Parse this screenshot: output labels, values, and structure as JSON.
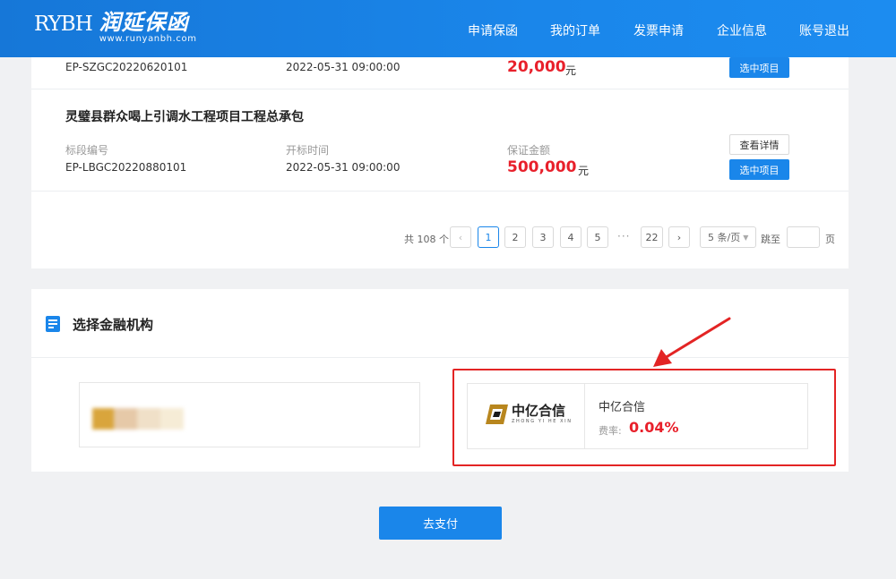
{
  "header": {
    "logo_abbr": "RYBH",
    "logo_cn": "润延保函",
    "logo_url": "www.runyanbh.com",
    "nav": [
      {
        "label": "申请保函"
      },
      {
        "label": "我的订单"
      },
      {
        "label": "发票申请"
      },
      {
        "label": "企业信息"
      },
      {
        "label": "账号退出"
      }
    ]
  },
  "projects": [
    {
      "code": "EP-SZGC20220620101",
      "open_time": "2022-05-31 09:00:00",
      "amount": "20,000",
      "currency": "元",
      "select_label": "选中项目"
    },
    {
      "title": "灵璧县群众喝上引调水工程项目工程总承包",
      "code_label": "标段编号",
      "code": "EP-LBGC20220880101",
      "time_label": "开标时间",
      "open_time": "2022-05-31 09:00:00",
      "amount_label": "保证金额",
      "amount": "500,000",
      "currency": "元",
      "detail_label": "查看详情",
      "select_label": "选中项目"
    }
  ],
  "pagination": {
    "total": "共 108 个",
    "prev": "‹",
    "pages": [
      "1",
      "2",
      "3",
      "4",
      "5"
    ],
    "ellipsis": "···",
    "last": "22",
    "next": "›",
    "page_size": "5 条/页",
    "jump_label": "跳至",
    "page_unit": "页",
    "current_page": 1
  },
  "institution_section": {
    "title": "选择金融机构",
    "selected": {
      "logo_cn": "中亿合信",
      "logo_pinyin": "ZHONG YI HE XIN",
      "name": "中亿合信",
      "rate_label": "费率:",
      "rate": "0.04%"
    }
  },
  "pay_button": "去支付",
  "colors": {
    "primary": "#1a86ea",
    "amount_red": "#e8202b",
    "highlight_red": "#e32424"
  }
}
